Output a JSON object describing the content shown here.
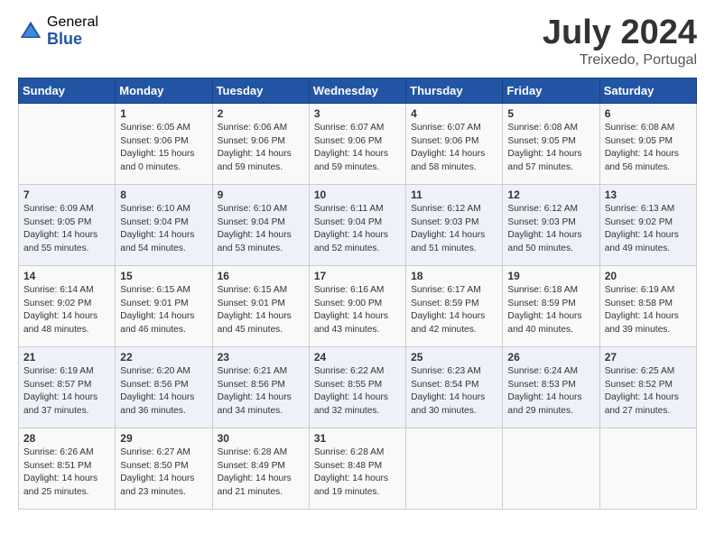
{
  "header": {
    "logo_general": "General",
    "logo_blue": "Blue",
    "month_year": "July 2024",
    "location": "Treixedo, Portugal"
  },
  "days_of_week": [
    "Sunday",
    "Monday",
    "Tuesday",
    "Wednesday",
    "Thursday",
    "Friday",
    "Saturday"
  ],
  "weeks": [
    [
      {
        "day": "",
        "info": ""
      },
      {
        "day": "1",
        "info": "Sunrise: 6:05 AM\nSunset: 9:06 PM\nDaylight: 15 hours\nand 0 minutes."
      },
      {
        "day": "2",
        "info": "Sunrise: 6:06 AM\nSunset: 9:06 PM\nDaylight: 14 hours\nand 59 minutes."
      },
      {
        "day": "3",
        "info": "Sunrise: 6:07 AM\nSunset: 9:06 PM\nDaylight: 14 hours\nand 59 minutes."
      },
      {
        "day": "4",
        "info": "Sunrise: 6:07 AM\nSunset: 9:06 PM\nDaylight: 14 hours\nand 58 minutes."
      },
      {
        "day": "5",
        "info": "Sunrise: 6:08 AM\nSunset: 9:05 PM\nDaylight: 14 hours\nand 57 minutes."
      },
      {
        "day": "6",
        "info": "Sunrise: 6:08 AM\nSunset: 9:05 PM\nDaylight: 14 hours\nand 56 minutes."
      }
    ],
    [
      {
        "day": "7",
        "info": "Sunrise: 6:09 AM\nSunset: 9:05 PM\nDaylight: 14 hours\nand 55 minutes."
      },
      {
        "day": "8",
        "info": "Sunrise: 6:10 AM\nSunset: 9:04 PM\nDaylight: 14 hours\nand 54 minutes."
      },
      {
        "day": "9",
        "info": "Sunrise: 6:10 AM\nSunset: 9:04 PM\nDaylight: 14 hours\nand 53 minutes."
      },
      {
        "day": "10",
        "info": "Sunrise: 6:11 AM\nSunset: 9:04 PM\nDaylight: 14 hours\nand 52 minutes."
      },
      {
        "day": "11",
        "info": "Sunrise: 6:12 AM\nSunset: 9:03 PM\nDaylight: 14 hours\nand 51 minutes."
      },
      {
        "day": "12",
        "info": "Sunrise: 6:12 AM\nSunset: 9:03 PM\nDaylight: 14 hours\nand 50 minutes."
      },
      {
        "day": "13",
        "info": "Sunrise: 6:13 AM\nSunset: 9:02 PM\nDaylight: 14 hours\nand 49 minutes."
      }
    ],
    [
      {
        "day": "14",
        "info": "Sunrise: 6:14 AM\nSunset: 9:02 PM\nDaylight: 14 hours\nand 48 minutes."
      },
      {
        "day": "15",
        "info": "Sunrise: 6:15 AM\nSunset: 9:01 PM\nDaylight: 14 hours\nand 46 minutes."
      },
      {
        "day": "16",
        "info": "Sunrise: 6:15 AM\nSunset: 9:01 PM\nDaylight: 14 hours\nand 45 minutes."
      },
      {
        "day": "17",
        "info": "Sunrise: 6:16 AM\nSunset: 9:00 PM\nDaylight: 14 hours\nand 43 minutes."
      },
      {
        "day": "18",
        "info": "Sunrise: 6:17 AM\nSunset: 8:59 PM\nDaylight: 14 hours\nand 42 minutes."
      },
      {
        "day": "19",
        "info": "Sunrise: 6:18 AM\nSunset: 8:59 PM\nDaylight: 14 hours\nand 40 minutes."
      },
      {
        "day": "20",
        "info": "Sunrise: 6:19 AM\nSunset: 8:58 PM\nDaylight: 14 hours\nand 39 minutes."
      }
    ],
    [
      {
        "day": "21",
        "info": "Sunrise: 6:19 AM\nSunset: 8:57 PM\nDaylight: 14 hours\nand 37 minutes."
      },
      {
        "day": "22",
        "info": "Sunrise: 6:20 AM\nSunset: 8:56 PM\nDaylight: 14 hours\nand 36 minutes."
      },
      {
        "day": "23",
        "info": "Sunrise: 6:21 AM\nSunset: 8:56 PM\nDaylight: 14 hours\nand 34 minutes."
      },
      {
        "day": "24",
        "info": "Sunrise: 6:22 AM\nSunset: 8:55 PM\nDaylight: 14 hours\nand 32 minutes."
      },
      {
        "day": "25",
        "info": "Sunrise: 6:23 AM\nSunset: 8:54 PM\nDaylight: 14 hours\nand 30 minutes."
      },
      {
        "day": "26",
        "info": "Sunrise: 6:24 AM\nSunset: 8:53 PM\nDaylight: 14 hours\nand 29 minutes."
      },
      {
        "day": "27",
        "info": "Sunrise: 6:25 AM\nSunset: 8:52 PM\nDaylight: 14 hours\nand 27 minutes."
      }
    ],
    [
      {
        "day": "28",
        "info": "Sunrise: 6:26 AM\nSunset: 8:51 PM\nDaylight: 14 hours\nand 25 minutes."
      },
      {
        "day": "29",
        "info": "Sunrise: 6:27 AM\nSunset: 8:50 PM\nDaylight: 14 hours\nand 23 minutes."
      },
      {
        "day": "30",
        "info": "Sunrise: 6:28 AM\nSunset: 8:49 PM\nDaylight: 14 hours\nand 21 minutes."
      },
      {
        "day": "31",
        "info": "Sunrise: 6:28 AM\nSunset: 8:48 PM\nDaylight: 14 hours\nand 19 minutes."
      },
      {
        "day": "",
        "info": ""
      },
      {
        "day": "",
        "info": ""
      },
      {
        "day": "",
        "info": ""
      }
    ]
  ]
}
